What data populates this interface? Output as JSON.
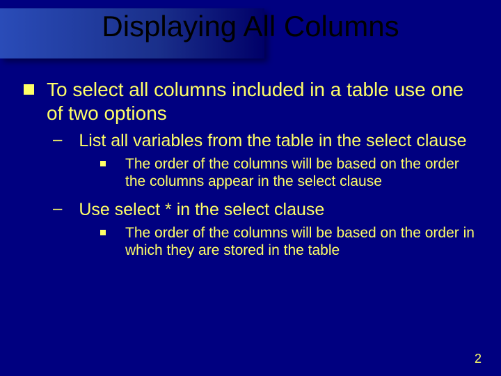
{
  "title": "Displaying All Columns",
  "bullets": {
    "l1": "To select all columns included in a table use one of two options",
    "l2a": "List all variables from the table in the select clause",
    "l3a": "The order of the columns will be based on the order the columns appear in the select clause",
    "l2b": "Use select * in the select clause",
    "l3b": "The order of the columns will be based on the order in which they are stored in the table"
  },
  "page_number": "2"
}
